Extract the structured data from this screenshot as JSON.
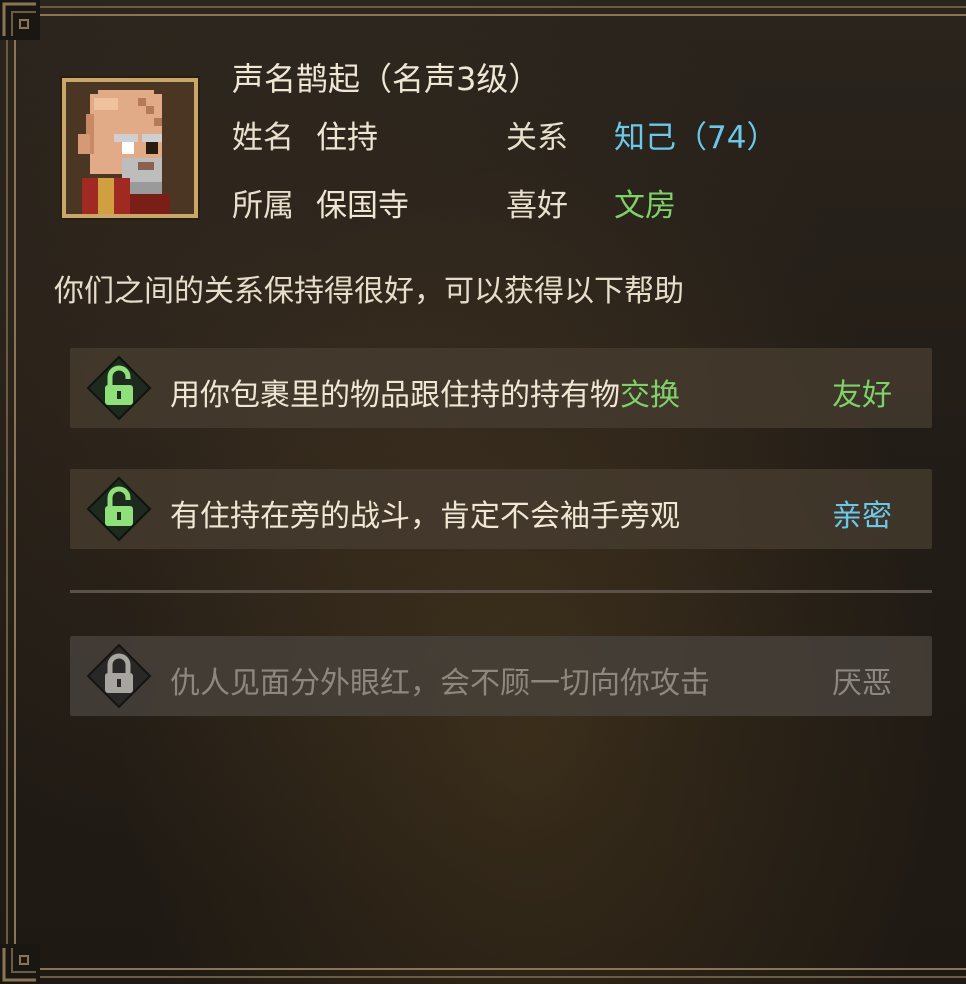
{
  "header": {
    "title": "声名鹊起（名声3级）",
    "name_label": "姓名",
    "name_value": "住持",
    "relation_label": "关系",
    "relation_value": "知己（74）",
    "faction_label": "所属",
    "faction_value": "保国寺",
    "hobby_label": "喜好",
    "hobby_value": "文房"
  },
  "description": "你们之间的关系保持得很好，可以获得以下帮助",
  "benefits": [
    {
      "text_before": "用你包裹里的物品跟住持的持有物",
      "text_highlight": "交换",
      "tag": "友好",
      "tag_color": "#7fd16a",
      "lock_icon": "unlocked-lock-icon",
      "unlocked": true
    },
    {
      "text_before": "有住持在旁的战斗，肯定不会袖手旁观",
      "text_highlight": "",
      "tag": "亲密",
      "tag_color": "#6cc8ea",
      "lock_icon": "unlocked-lock-icon",
      "unlocked": true
    },
    {
      "text_before": "仇人见面分外眼红，会不顾一切向你攻击",
      "text_highlight": "",
      "tag": "厌恶",
      "tag_color": "#8d8780",
      "lock_icon": "locked-lock-icon",
      "unlocked": false
    }
  ],
  "colors": {
    "accent_green": "#7fd16a",
    "accent_blue": "#6cc8ea",
    "frame_gold": "#c9a76a"
  }
}
